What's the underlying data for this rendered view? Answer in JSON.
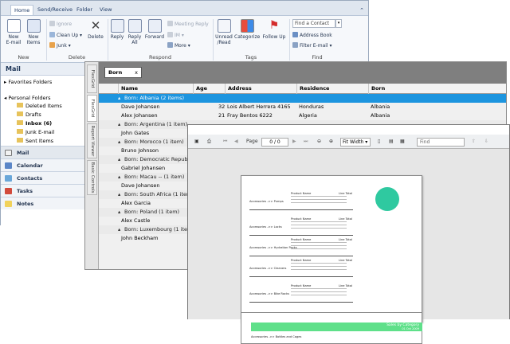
{
  "ribbon": {
    "tabs": [
      "Home",
      "Send/Receive",
      "Folder",
      "View"
    ],
    "new": {
      "new_email": "New\nE-mail",
      "new_items": "New\nItems",
      "group": "New"
    },
    "delete": {
      "ignore": "Ignore",
      "cleanup": "Clean Up",
      "junk": "Junk",
      "delete": "Delete",
      "group": "Delete"
    },
    "respond": {
      "reply": "Reply",
      "reply_all": "Reply\nAll",
      "forward": "Forward",
      "meeting_reply": "Meeting Reply",
      "im": "IM",
      "more": "More",
      "group": "Respond"
    },
    "tags": {
      "unread_read": "Unread\n/Read",
      "categorize": "Categorize",
      "follow_up": "Follow Up",
      "group": "Tags"
    },
    "find": {
      "find_contact_placeholder": "Find a Contact",
      "address_book": "Address Book",
      "filter_email": "Filter E-mail",
      "group": "Find"
    }
  },
  "nav": {
    "title": "Mail",
    "favorites": "Favorites Folders",
    "personal": "Personal Folders",
    "folders": [
      "Deleted Items",
      "Drafts",
      "Inbox (6)",
      "Junk E-mail",
      "Sent Items"
    ],
    "panes": [
      "Mail",
      "Calendar",
      "Contacts",
      "Tasks",
      "Notes"
    ]
  },
  "grid": {
    "vertical_tabs": [
      "FlexGrid",
      "FlexGrid",
      "Report Viewer",
      "Basic Controls"
    ],
    "group_chip": "Born",
    "columns": [
      "Name",
      "Age",
      "Address",
      "Residence",
      "Born"
    ],
    "rows": [
      {
        "type": "group",
        "text": "Born: Albania (2 items)",
        "selected": true
      },
      {
        "type": "data",
        "name": "Dave Johansen",
        "age": "32",
        "address": "Lois Albert Herrera 4165",
        "residence": "Honduras",
        "born": "Albania"
      },
      {
        "type": "data",
        "name": "Alex Johansen",
        "age": "21",
        "address": "Fray Bentos 6222",
        "residence": "Algeria",
        "born": "Albania"
      },
      {
        "type": "group",
        "text": "Born: Argentina (1 item)"
      },
      {
        "type": "data",
        "name": "John Gates"
      },
      {
        "type": "group",
        "text": "Born: Morocco (1 item)"
      },
      {
        "type": "data",
        "name": "Bruno Johnson"
      },
      {
        "type": "group",
        "text": "Born: Democratic Republic"
      },
      {
        "type": "data",
        "name": "Gabriel Johansen"
      },
      {
        "type": "group",
        "text": "Born: Macau -- (1 item)"
      },
      {
        "type": "data",
        "name": "Dave Johansen"
      },
      {
        "type": "group",
        "text": "Born: South Africa (1 item)"
      },
      {
        "type": "data",
        "name": "Alex Garcia"
      },
      {
        "type": "group",
        "text": "Born: Poland (1 item)"
      },
      {
        "type": "data",
        "name": "Alex Castle"
      },
      {
        "type": "group",
        "text": "Born: Luxembourg (1 item)"
      },
      {
        "type": "data",
        "name": "John Beckham"
      }
    ]
  },
  "viewer": {
    "page_label": "Page",
    "page_value": "0",
    "page_of": "/ 0",
    "zoom": "Fit Width",
    "find_placeholder": "Find",
    "report_title": "Sales by Category",
    "report_date": "01 Oct 2009",
    "sections": [
      "Accessories ->> Pumps",
      "Accessories ->> Locks",
      "Accessories ->> Hydration Packs",
      "Accessories ->> Cleaners",
      "Accessories ->> Bike Racks",
      "Accessories ->> Bottles and Cages"
    ],
    "subheaders": [
      "Product Name",
      "Line Total"
    ]
  },
  "colors": {
    "selected_row": "#1d95df",
    "report_band": "#5fe08a",
    "pie": "#2fc9a0"
  }
}
